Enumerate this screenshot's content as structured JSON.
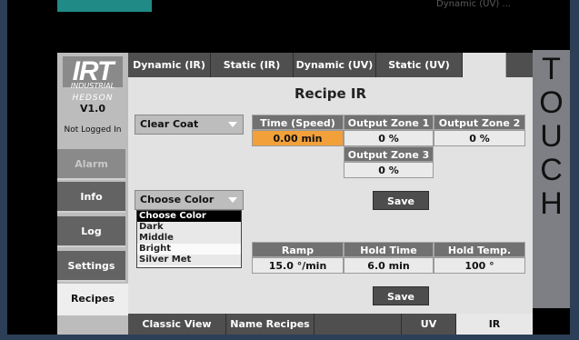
{
  "top_status": "Dynamic (UV) ...",
  "touch_label": [
    "T",
    "O",
    "U",
    "C",
    "H"
  ],
  "logo": {
    "brand": "IRT",
    "sub": "INDUSTRIAL",
    "hedson": "HEDSON"
  },
  "version": "V1.0",
  "login_status": "Not Logged In",
  "nav": {
    "alarm": "Alarm",
    "info": "Info",
    "log": "Log",
    "settings": "Settings",
    "recipes": "Recipes"
  },
  "tabs": {
    "dynamic_ir": "Dynamic (IR)",
    "static_ir": "Static (IR)",
    "dynamic_uv": "Dynamic (UV)",
    "static_uv": "Static (UV)"
  },
  "page_title": "Recipe IR",
  "coat_select": {
    "value": "Clear Coat"
  },
  "color_select": {
    "value": "Choose Color",
    "options": [
      "Choose Color",
      "Dark",
      "Middle",
      "Bright",
      "Silver Met"
    ]
  },
  "table1": {
    "headers": [
      "Time (Speed)",
      "Output Zone 1",
      "Output Zone 2"
    ],
    "values": [
      "0.00 min",
      "0 %",
      "0 %"
    ],
    "zone3_header": "Output Zone 3",
    "zone3_value": "0 %"
  },
  "save_label": "Save",
  "table2": {
    "headers": [
      "Ramp",
      "Hold Time",
      "Hold Temp."
    ],
    "values": [
      "15.0 °/min",
      "6.0 min",
      "100 °"
    ]
  },
  "bottom_tabs": {
    "classic": "Classic View",
    "names": "Name Recipes",
    "uv": "UV",
    "ir": "IR"
  },
  "colors": {
    "highlight_cell": "#f2a03a",
    "frame": "#2d3f57",
    "accent_teal": "#1f8a86"
  }
}
